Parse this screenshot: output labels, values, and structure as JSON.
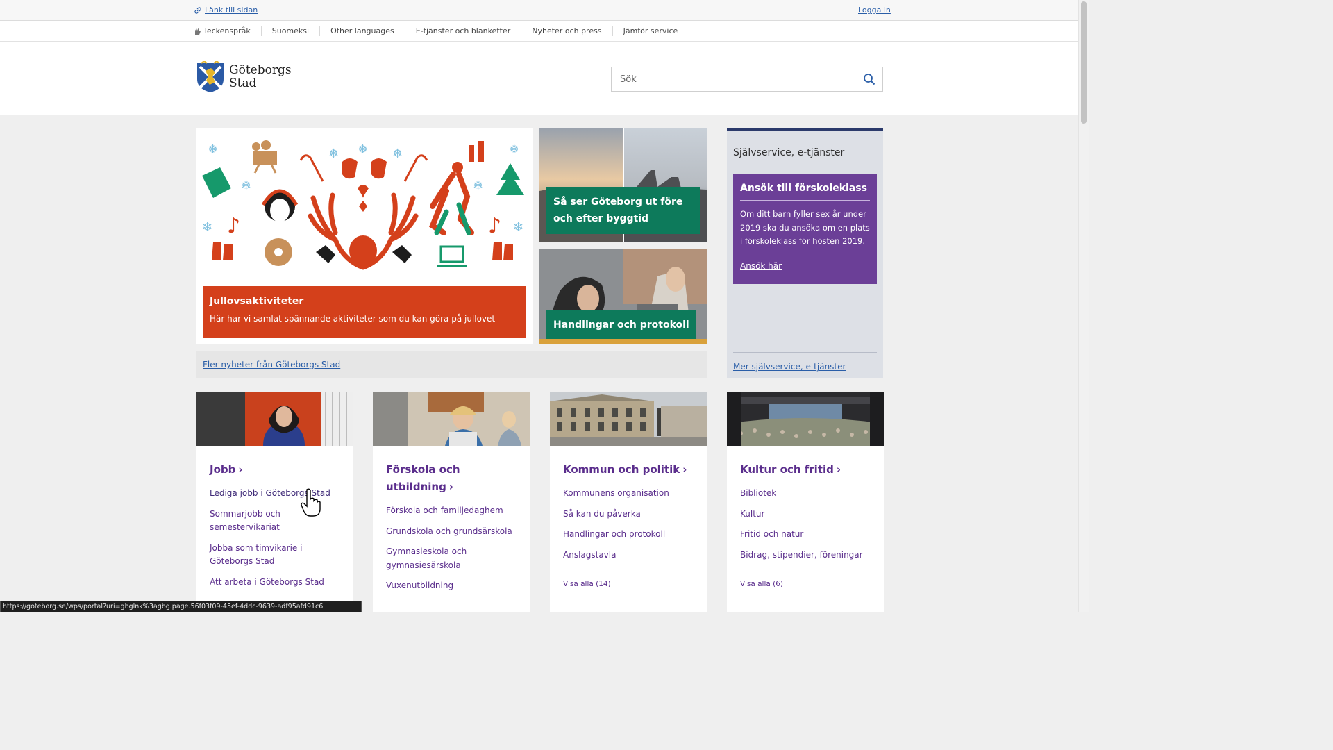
{
  "topbar": {
    "link_page": "Länk till sidan",
    "login": "Logga in"
  },
  "secnav": [
    "Teckenspråk",
    "Suomeksi",
    "Other languages",
    "E-tjänster och blanketter",
    "Nyheter och press",
    "Jämför service"
  ],
  "logo": {
    "line1": "Göteborgs",
    "line2": "Stad"
  },
  "search": {
    "placeholder": "Sök"
  },
  "hero": {
    "title": "Jullovsaktiviteter",
    "text": "Här har vi samlat spännande aktiviteter som du kan göra på jullovet"
  },
  "news": [
    {
      "title": "Så ser Göteborg ut före och efter byggtid"
    },
    {
      "title": "Handlingar och protokoll"
    }
  ],
  "more_news": "Fler nyheter från Göteborgs Stad",
  "selfservice": {
    "heading": "Självservice, e-tjänster",
    "promo_title": "Ansök till förskoleklass",
    "promo_text": "Om ditt barn fyller sex år under 2019 ska du ansöka om en plats i förskoleklass för hösten 2019.",
    "promo_link": "Ansök här",
    "more": "Mer självservice, e-tjänster"
  },
  "cards": [
    {
      "title": "Jobb",
      "links": [
        "Lediga jobb i Göteborgs Stad",
        "Sommarjobb och semestervikariat",
        "Jobba som timvikarie i Göteborgs Stad",
        "Att arbeta i Göteborgs Stad"
      ]
    },
    {
      "title": "Förskola och utbildning",
      "links": [
        "Förskola och familjedaghem",
        "Grundskola och grundsärskola",
        "Gymnasieskola och gymnasiesärskola",
        "Vuxenutbildning"
      ]
    },
    {
      "title": "Kommun och politik",
      "links": [
        "Kommunens organisation",
        "Så kan du påverka",
        "Handlingar och protokoll",
        "Anslagstavla"
      ],
      "visa": "Visa alla (14)"
    },
    {
      "title": "Kultur och fritid",
      "links": [
        "Bibliotek",
        "Kultur",
        "Fritid och natur",
        "Bidrag, stipendier, föreningar"
      ],
      "visa": "Visa alla (6)"
    }
  ],
  "status_url": "https://goteborg.se/wps/portal?uri=gbglnk%3agbg.page.56f03f09-45ef-4ddc-9639-adf95afd91c6",
  "colors": {
    "accent_purple": "#5a2d8c",
    "hero_orange": "#d4401b",
    "news_green": "#0d7a5b",
    "link_blue": "#2a5ea8"
  }
}
